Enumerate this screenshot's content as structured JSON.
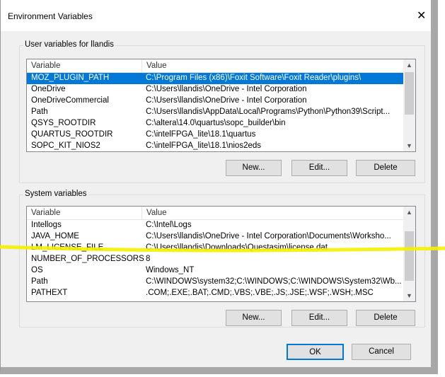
{
  "window": {
    "title": "Environment Variables",
    "close": "✕"
  },
  "user": {
    "label": "User variables for llandis",
    "col_variable": "Variable",
    "col_value": "Value",
    "rows": [
      {
        "variable": "MOZ_PLUGIN_PATH",
        "value": "C:\\Program Files (x86)\\Foxit Software\\Foxit Reader\\plugins\\"
      },
      {
        "variable": "OneDrive",
        "value": "C:\\Users\\llandis\\OneDrive - Intel Corporation"
      },
      {
        "variable": "OneDriveCommercial",
        "value": "C:\\Users\\llandis\\OneDrive - Intel Corporation"
      },
      {
        "variable": "Path",
        "value": "C:\\Users\\llandis\\AppData\\Local\\Programs\\Python\\Python39\\Script..."
      },
      {
        "variable": "QSYS_ROOTDIR",
        "value": "C:\\altera\\14.0\\quartus\\sopc_builder\\bin"
      },
      {
        "variable": "QUARTUS_ROOTDIR",
        "value": "C:\\intelFPGA_lite\\18.1\\quartus"
      },
      {
        "variable": "SOPC_KIT_NIOS2",
        "value": "C:\\intelFPGA_lite\\18.1\\nios2eds"
      }
    ],
    "new": "New...",
    "edit": "Edit...",
    "delete": "Delete"
  },
  "system": {
    "label": "System variables",
    "col_variable": "Variable",
    "col_value": "Value",
    "rows": [
      {
        "variable": "Intellogs",
        "value": "C:\\Intel\\Logs"
      },
      {
        "variable": "JAVA_HOME",
        "value": "C:\\Users\\llandis\\OneDrive - Intel Corporation\\Documents\\Worksho..."
      },
      {
        "variable": "LM_LICENSE_FILE",
        "value": "C:\\Users\\llandis\\Downloads\\Questasim\\license.dat"
      },
      {
        "variable": "NUMBER_OF_PROCESSORS",
        "value": "8"
      },
      {
        "variable": "OS",
        "value": "Windows_NT"
      },
      {
        "variable": "Path",
        "value": "C:\\WINDOWS\\system32;C:\\WINDOWS;C:\\WINDOWS\\System32\\Wb..."
      },
      {
        "variable": "PATHEXT",
        "value": ".COM;.EXE;.BAT;.CMD;.VBS;.VBE;.JS;.JSE;.WSF;.WSH;.MSC"
      }
    ],
    "new": "New...",
    "edit": "Edit...",
    "delete": "Delete"
  },
  "footer": {
    "ok": "OK",
    "cancel": "Cancel"
  },
  "colors": {
    "selection": "#0078d7",
    "highlight": "#f5f000"
  }
}
